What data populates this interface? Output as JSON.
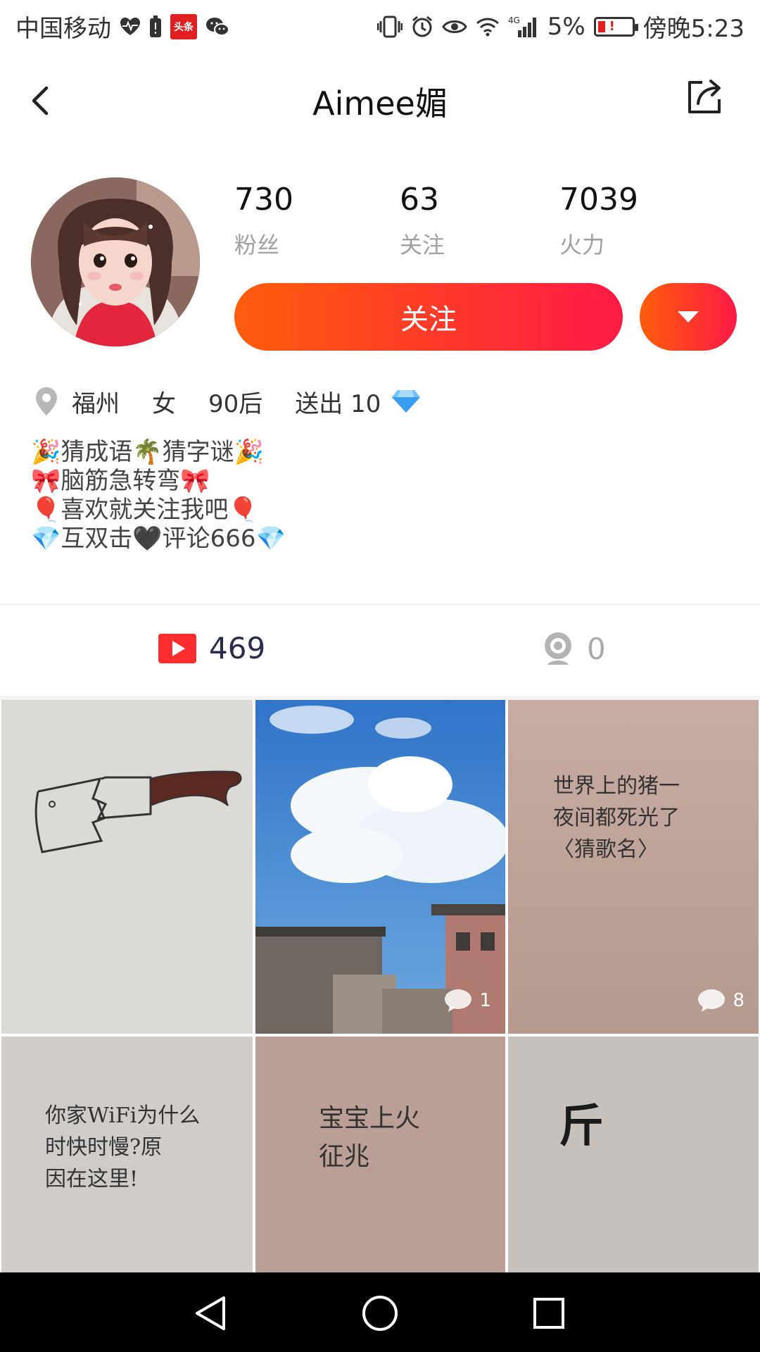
{
  "status_bar": {
    "carrier": "中国移动",
    "toutiao_badge": "头条",
    "network": "4G",
    "battery_percent": "5%",
    "time": "傍晚5:23",
    "icons": [
      "heartbeat-icon",
      "battery-saver-icon",
      "toutiao-icon",
      "wechat-icon",
      "vibrate-icon",
      "alarm-icon",
      "eye-icon",
      "wifi-icon",
      "signal-icon",
      "battery-icon"
    ]
  },
  "header": {
    "title": "Aimee媚",
    "back_icon": "chevron-left-icon",
    "share_icon": "share-icon"
  },
  "profile": {
    "stats": [
      {
        "value": "730",
        "label": "粉丝"
      },
      {
        "value": "63",
        "label": "关注"
      },
      {
        "value": "7039",
        "label": "火力"
      }
    ],
    "follow_label": "关注",
    "more_icon": "caret-down-icon",
    "location": "福州",
    "gender": "女",
    "generation": "90后",
    "gifts_label": "送出 10",
    "gift_icon": "diamond-icon",
    "bio": [
      "🎉猜成语🌴猜字谜🎉",
      "🎀脑筋急转弯🎀",
      "🎈喜欢就关注我吧🎈",
      "💎互双击🖤评论666💎"
    ]
  },
  "tabs": {
    "videos_count": "469",
    "live_count": "0"
  },
  "grid": {
    "tiles": [
      {
        "note": "",
        "comments": ""
      },
      {
        "note": "",
        "comments": "1"
      },
      {
        "note": "世界上的猪一\n夜间都死光了\n〈猜歌名〉",
        "comments": "8"
      },
      {
        "note": "你家WiFi为什么\n时快时慢?原\n因在这里!",
        "comments": ""
      },
      {
        "note": "宝宝上火\n征兆",
        "comments": ""
      },
      {
        "note": "斤",
        "comments": ""
      }
    ]
  },
  "colors": {
    "accent_start": "#ff5d0c",
    "accent_end": "#ff1a45",
    "video_icon": "#ff2d2d"
  }
}
